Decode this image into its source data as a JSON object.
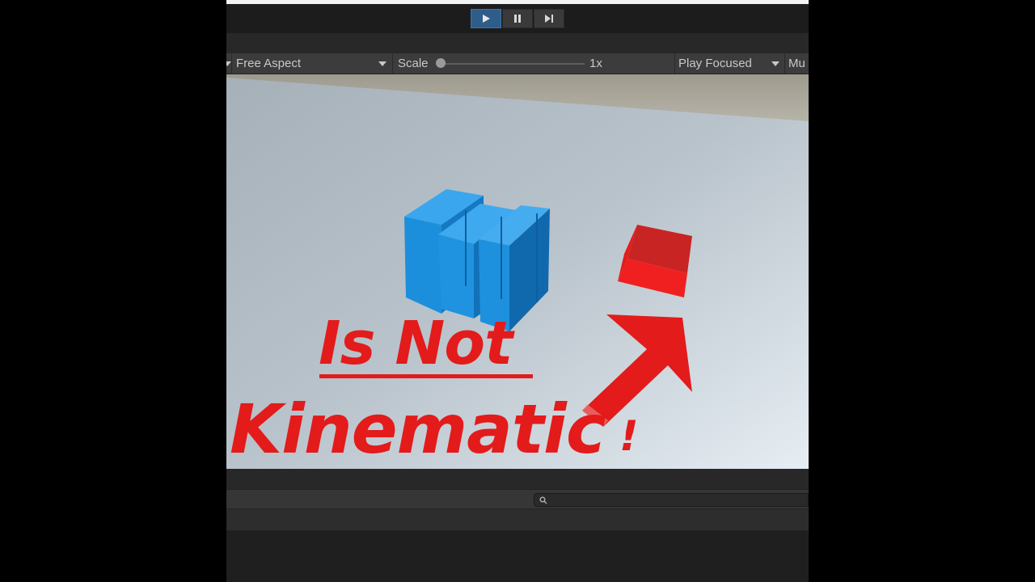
{
  "play_toolbar": {
    "buttons": [
      {
        "icon": "play-icon",
        "active": true
      },
      {
        "icon": "pause-icon",
        "active": false
      },
      {
        "icon": "step-icon",
        "active": false
      }
    ]
  },
  "game_toolbar": {
    "aspect_label": "Free Aspect",
    "scale_label": "Scale",
    "scale_value": "1x",
    "play_mode_label": "Play Focused",
    "mute_label_partial": "Mu"
  },
  "overlay": {
    "line1": "Is Not",
    "line2": "Kinematic",
    "line2_end": "!"
  },
  "colors": {
    "overlay_red": "#e31b1b",
    "cube_blue": "#1f8fd9",
    "cube_red": "#e11919",
    "play_active": "#2f5d8a"
  }
}
